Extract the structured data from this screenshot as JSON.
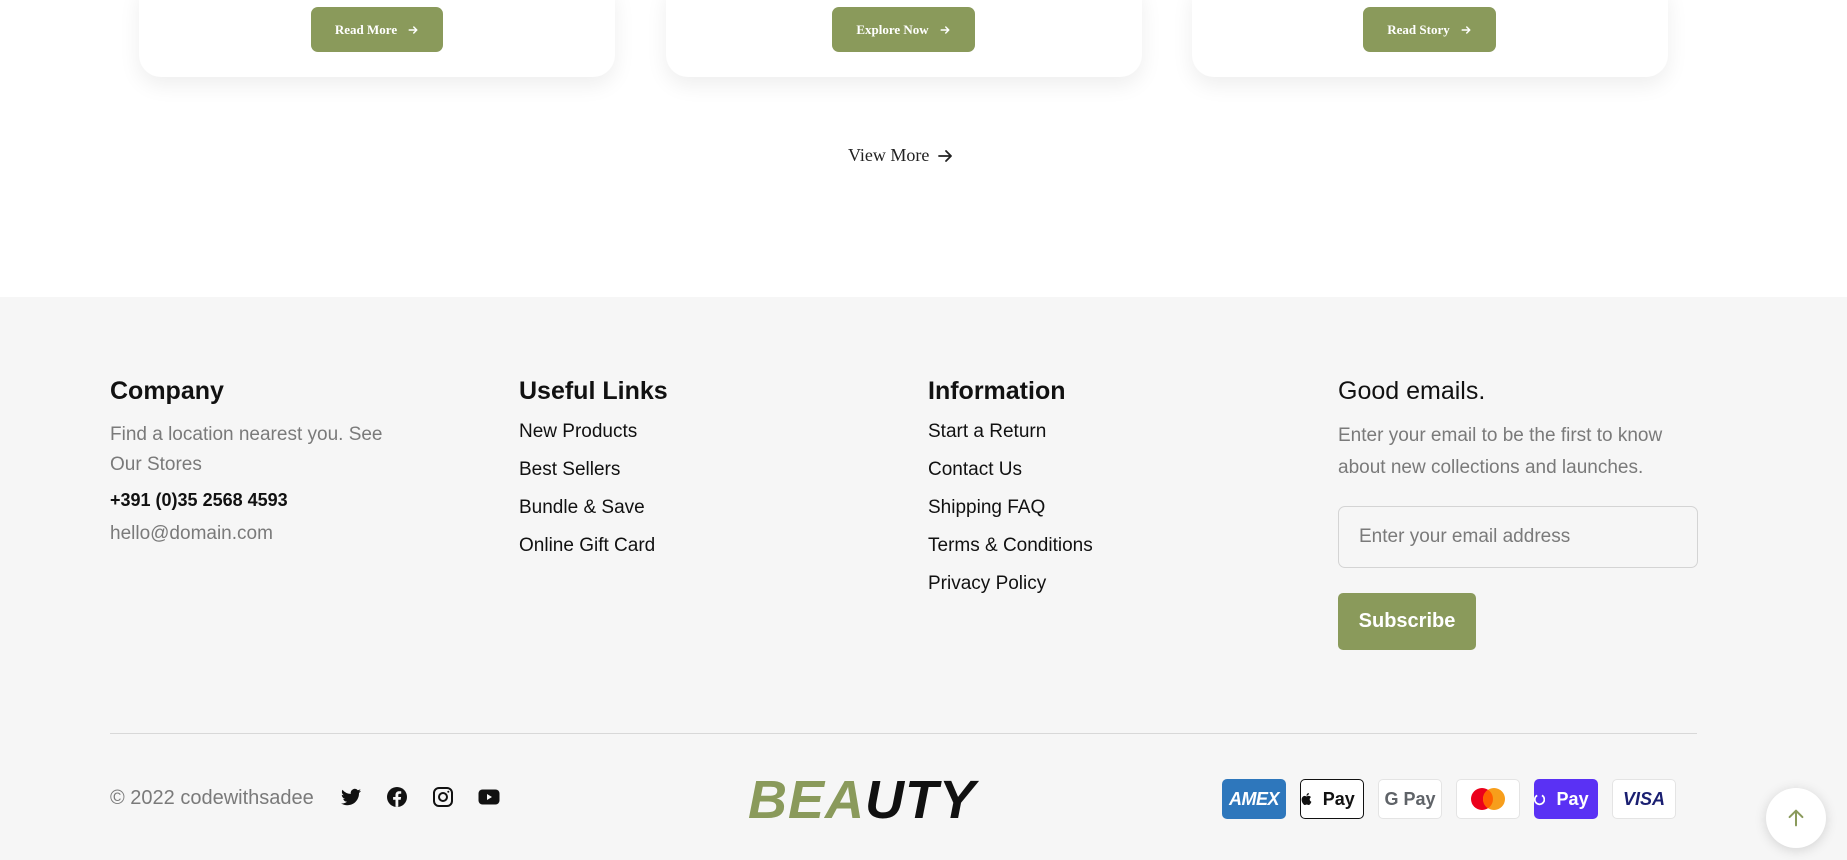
{
  "cards": [
    {
      "button_label": "Read More"
    },
    {
      "button_label": "Explore Now"
    },
    {
      "button_label": "Read Story"
    }
  ],
  "view_more_label": "View More",
  "footer": {
    "company": {
      "title": "Company",
      "description": "Find a location nearest you. See Our Stores",
      "phone": "+391 (0)35 2568 4593",
      "email": "hello@domain.com"
    },
    "useful_links": {
      "title": "Useful Links",
      "items": [
        "New Products",
        "Best Sellers",
        "Bundle & Save",
        "Online Gift Card"
      ]
    },
    "information": {
      "title": "Information",
      "items": [
        "Start a Return",
        "Contact Us",
        "Shipping FAQ",
        "Terms & Conditions",
        "Privacy Policy"
      ]
    },
    "newsletter": {
      "title": "Good emails.",
      "description": "Enter your email to be the first to know about new collections and launches.",
      "placeholder": "Enter your email address",
      "button_label": "Subscribe"
    },
    "copyright": "© 2022 codewithsadee",
    "socials": [
      "twitter-icon",
      "facebook-icon",
      "instagram-icon",
      "youtube-icon"
    ],
    "logo": {
      "part1": "BEA",
      "part2": "UTY"
    },
    "payments": [
      {
        "name": "amex",
        "label": "AMEX"
      },
      {
        "name": "apple-pay",
        "label": "Pay"
      },
      {
        "name": "google-pay",
        "label": "G Pay"
      },
      {
        "name": "mastercard",
        "label": ""
      },
      {
        "name": "shop-pay",
        "label": "Pay"
      },
      {
        "name": "visa",
        "label": "VISA"
      }
    ]
  },
  "colors": {
    "accent": "#8a9a5b",
    "footer_bg": "#f6f6f6",
    "text": "#111111",
    "muted": "#7a7a7a"
  }
}
